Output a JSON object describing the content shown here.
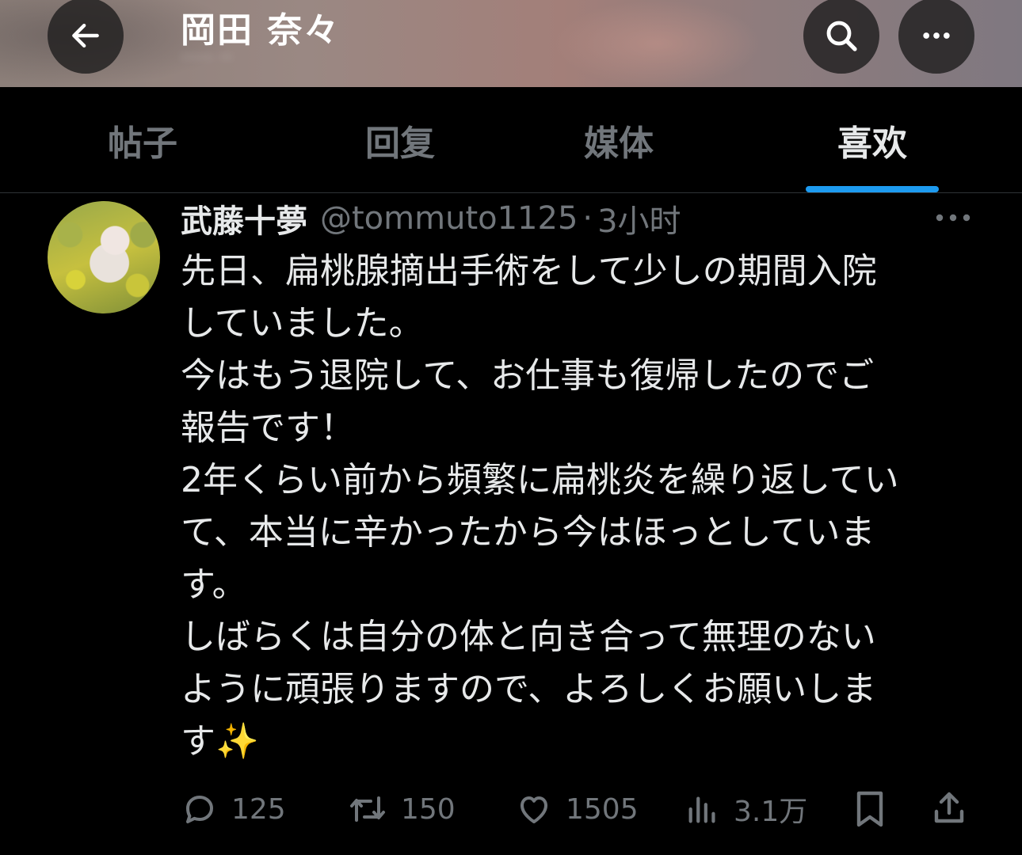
{
  "header": {
    "title": "岡田 奈々",
    "subtitle": "····· ··",
    "back_icon": "arrow-left-icon",
    "search_icon": "search-icon",
    "more_icon": "ellipsis-icon"
  },
  "tabs": [
    {
      "label": "帖子",
      "active": false
    },
    {
      "label": "回复",
      "active": false
    },
    {
      "label": "媒体",
      "active": false
    },
    {
      "label": "喜欢",
      "active": true
    }
  ],
  "accent_color": "#1d9bf0",
  "tweet": {
    "display_name": "武藤十夢",
    "handle": "@tommuto1125",
    "separator": "·",
    "time": "3小时",
    "body": "先日、扁桃腺摘出手術をして少しの期間入院\nしていました。\n今はもう退院して、お仕事も復帰したのでご\n報告です！\n2年くらい前から頻繁に扁桃炎を繰り返してい\nて、本当に辛かったから今はほっとしていま\nす。\nしばらくは自分の体と向き合って無理のない\nように頑張りますので、よろしくお願いしま\nす",
    "emoji": "✨",
    "actions": {
      "replies": "125",
      "reposts": "150",
      "likes": "1505",
      "views": "3.1万"
    }
  }
}
